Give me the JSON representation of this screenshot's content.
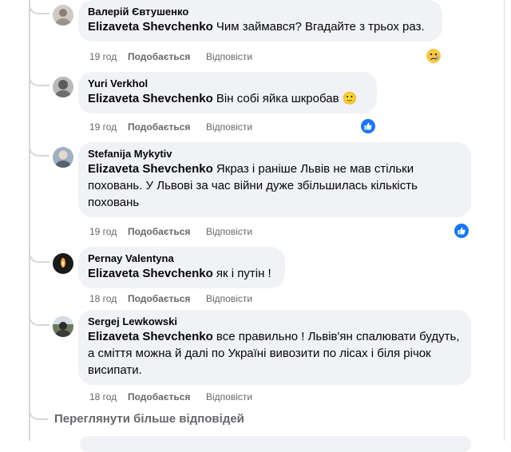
{
  "comments": [
    {
      "author": "Валерій Євтушенко",
      "mention": "Elizaveta Shevchenko",
      "text": " Чим займався? Вгадайте з трьох раз.",
      "time": "19 год",
      "like": "Подобається",
      "reply": "Відповісти",
      "reaction": "sad-emoji"
    },
    {
      "author": "Yuri Verkhol",
      "mention": "Elizaveta Shevchenko",
      "text": " Він собі яйка шкробав",
      "emoji": "🙂",
      "time": "19 год",
      "like": "Подобається",
      "reply": "Відповісти",
      "reaction": "like-thumb"
    },
    {
      "author": "Stefanija Mykytiv",
      "mention": "Elizaveta Shevchenko",
      "text": " Якраз і раніше Львів не мав стільки поховань. У Львові за час війни дуже збільшилась кількість поховань",
      "time": "19 год",
      "like": "Подобається",
      "reply": "Відповісти",
      "reaction": "like-thumb"
    },
    {
      "author": "Pernay Valentyna",
      "mention": "Elizaveta Shevchenko",
      "text": " як і путін !",
      "time": "18 год",
      "like": "Подобається",
      "reply": "Відповісти"
    },
    {
      "author": "Sergej Lewkowski",
      "mention": "Elizaveta Shevchenko",
      "text": " все правильно ! Львів'ян спалювати будуть, а сміття можна й далі по Україні вивозити по лісах і біля річок висипати.",
      "time": "18 год",
      "like": "Подобається",
      "reply": "Відповісти"
    }
  ],
  "more_replies": "Переглянути більше відповідей",
  "colors": {
    "bubble": "#f0f2f5",
    "meta": "#65676b",
    "like_blue": "#1877f2",
    "sad_yellow": "#f7c948"
  }
}
